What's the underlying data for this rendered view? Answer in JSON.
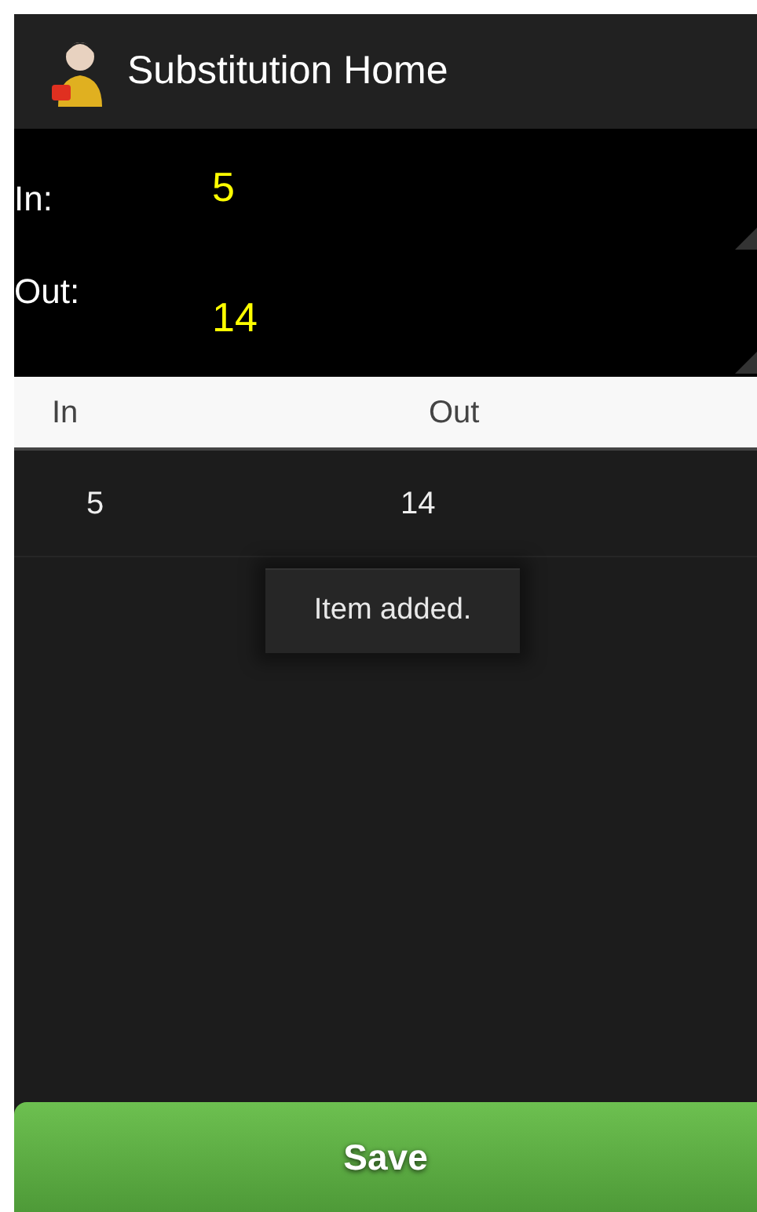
{
  "action_bar": {
    "title": "Substitution Home"
  },
  "form": {
    "fields": [
      {
        "label": "In:",
        "value": "5"
      },
      {
        "label": "Out:",
        "value": "14"
      }
    ]
  },
  "table": {
    "columns": [
      "In",
      "Out"
    ],
    "rows": [
      [
        "5",
        "14"
      ]
    ]
  },
  "toast": {
    "text": "Item added."
  },
  "save_button": {
    "label": "Save"
  }
}
